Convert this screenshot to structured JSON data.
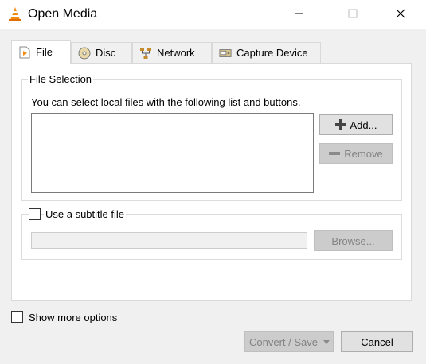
{
  "window": {
    "title": "Open Media"
  },
  "tabs": [
    {
      "label": "File"
    },
    {
      "label": "Disc"
    },
    {
      "label": "Network"
    },
    {
      "label": "Capture Device"
    }
  ],
  "file_selection": {
    "group_title": "File Selection",
    "instruction": "You can select local files with the following list and buttons.",
    "add_label": "Add...",
    "remove_label": "Remove"
  },
  "subtitle": {
    "checkbox_label": "Use a subtitle file",
    "browse_label": "Browse..."
  },
  "footer": {
    "show_more_label": "Show more options",
    "convert_label": "Convert / Save",
    "cancel_label": "Cancel"
  }
}
